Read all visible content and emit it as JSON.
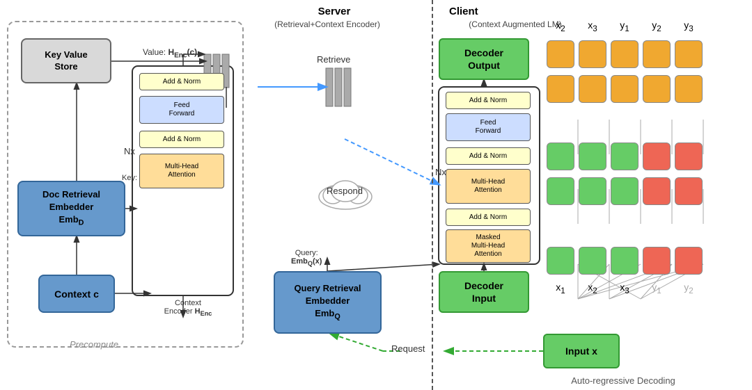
{
  "header": {
    "server_label": "Server",
    "server_sublabel": "(Retrieval+Context Encoder)",
    "client_label": "Client",
    "client_sublabel": "(Context Augmented LM)"
  },
  "left": {
    "precompute_label": "Precompute",
    "kv_store_label": "Key Value\nStore",
    "doc_embedder_label": "Doc Retrieval\nEmbedder\nEmbD",
    "context_c_label": "Context c",
    "value_label": "Value: HEnc(c)",
    "key_label": "Key: EmbD(c)",
    "context_enc_label": "Context\nEncoder HEnc",
    "nx_label": "Nx",
    "add_norm_1": "Add & Norm",
    "feed_forward": "Feed\nForward",
    "add_norm_2": "Add & Norm",
    "multi_head": "Multi-Head\nAttention"
  },
  "middle": {
    "retrieve_label": "Retrieve",
    "respond_label": "Respond",
    "query_embedder_label": "Query Retrieval\nEmbedder\nEmbQ",
    "query_label": "Query:\nEmbQ(x)",
    "request_label": "Request"
  },
  "right": {
    "decoder_output_label": "Decoder\nOutput",
    "decoder_input_label": "Decoder\nInput",
    "input_x_label": "Input x",
    "autoregressive_label": "Auto-regressive Decoding",
    "nx_label": "Nx",
    "add_norm_1": "Add & Norm",
    "feed_forward": "Feed\nForward",
    "add_norm_2": "Add & Norm",
    "multi_head": "Multi-Head\nAttention",
    "add_norm_3": "Add & Norm",
    "masked_multi": "Masked\nMulti-Head\nAttention",
    "token_labels_top": [
      "x₂",
      "x₃",
      "y₁",
      "y₂",
      "y₃"
    ],
    "token_labels_bottom": [
      "x₁",
      "x₂",
      "x₃",
      "y₁",
      "y₂"
    ],
    "grid_rows": {
      "row1": [
        "orange",
        "orange",
        "orange",
        "orange",
        "orange"
      ],
      "row2": [
        "orange",
        "orange",
        "orange",
        "orange",
        "orange"
      ],
      "row3": [
        "green",
        "green",
        "green",
        "red",
        "red"
      ],
      "row4": [
        "green",
        "green",
        "green",
        "red",
        "red"
      ]
    }
  }
}
